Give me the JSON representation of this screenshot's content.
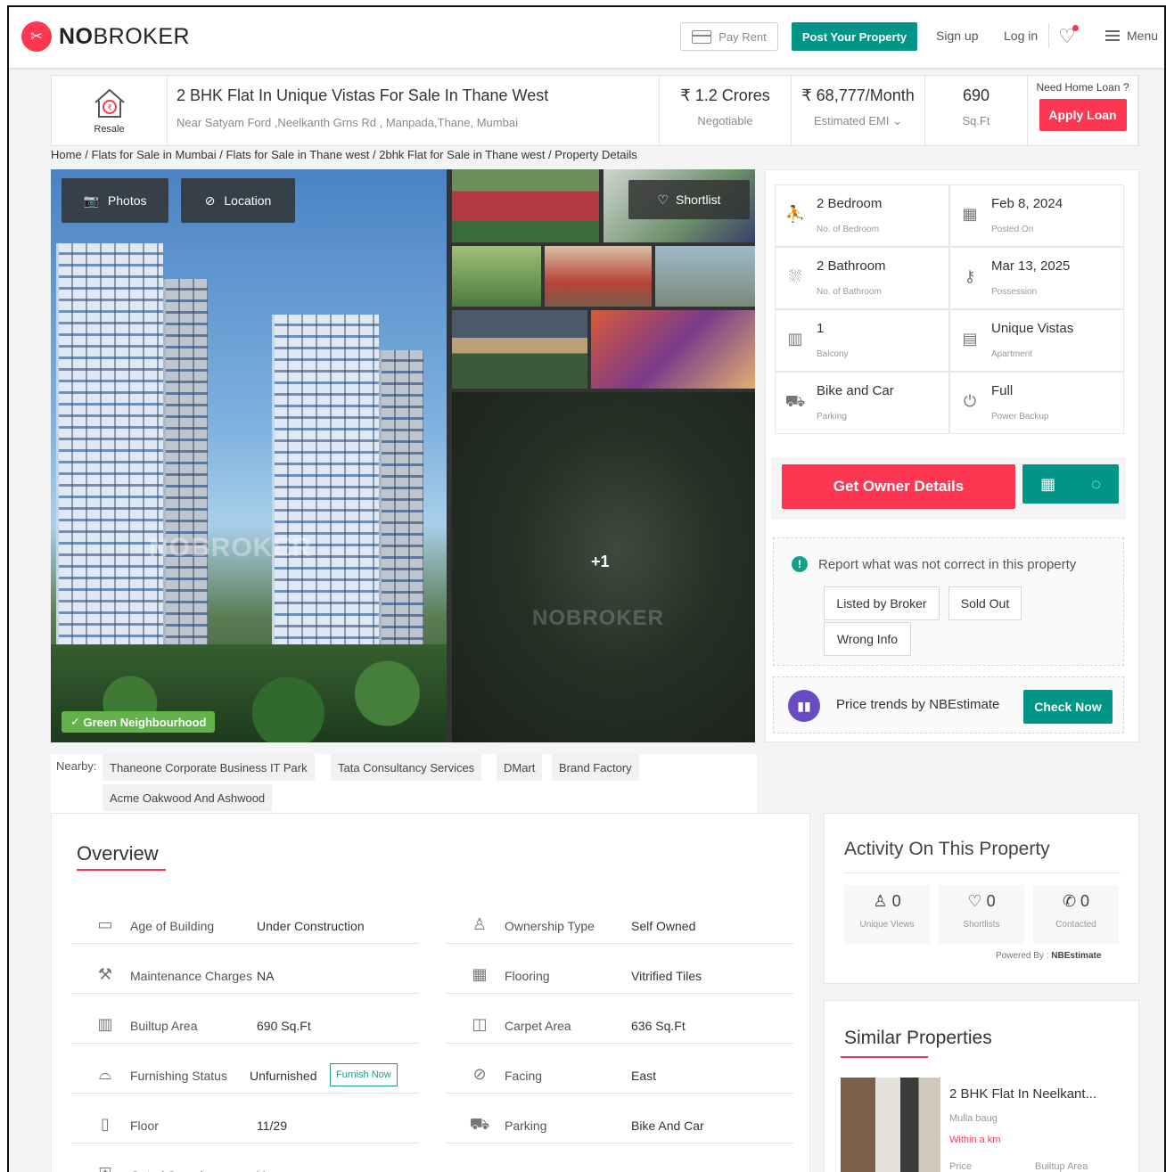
{
  "header": {
    "brand_bold": "NO",
    "brand_rest": "BROKER",
    "pay_rent": "Pay Rent",
    "post_property": "Post Your Property",
    "sign_up": "Sign up",
    "log_in": "Log in",
    "menu": "Menu"
  },
  "property": {
    "resale_label": "Resale",
    "title": "2 BHK Flat In Unique Vistas For Sale In Thane West",
    "address": "Near Satyam Ford ,Neelkanth Grns Rd , Manpada,Thane, Mumbai",
    "price": "₹ 1.2 Crores",
    "price_sub": "Negotiable",
    "emi": "₹ 68,777/Month",
    "emi_sub": "Estimated EMI",
    "area": "690",
    "area_sub": "Sq.Ft",
    "loan_q": "Need Home Loan ?",
    "apply_loan": "Apply Loan"
  },
  "breadcrumb": "Home / Flats for Sale in Mumbai / Flats for Sale in Thane west / 2bhk Flat for Sale in Thane west / Property Details",
  "gallery": {
    "photos": "Photos",
    "location": "Location",
    "shortlist": "Shortlist",
    "badge": "Green Neighbourhood",
    "more": "+1",
    "watermark": "NOBROKER"
  },
  "specs": [
    {
      "value": "2 Bedroom",
      "label": "No. of Bedroom"
    },
    {
      "value": "Feb 8, 2024",
      "label": "Posted On"
    },
    {
      "value": "2 Bathroom",
      "label": "No. of Bathroom"
    },
    {
      "value": "Mar 13, 2025",
      "label": "Possession"
    },
    {
      "value": "1",
      "label": "Balcony"
    },
    {
      "value": "Unique Vistas",
      "label": "Apartment"
    },
    {
      "value": "Bike and Car",
      "label": "Parking"
    },
    {
      "value": "Full",
      "label": "Power Backup"
    }
  ],
  "owner": {
    "button": "Get Owner Details"
  },
  "report": {
    "title": "Report what was not correct in this property",
    "options": [
      "Listed by Broker",
      "Sold Out",
      "Wrong Info"
    ]
  },
  "trend": {
    "text": "Price trends by NBEstimate",
    "button": "Check Now"
  },
  "nearby": {
    "label": "Nearby:",
    "items": [
      "Thaneone Corporate Business IT Park",
      "Tata Consultancy Services",
      "DMart",
      "Brand Factory",
      "Acme Oakwood And Ashwood"
    ]
  },
  "overview": {
    "title": "Overview",
    "furnish_now": "Furnish Now",
    "left": [
      {
        "k": "Age of Building",
        "v": "Under Construction"
      },
      {
        "k": "Maintenance Charges",
        "v": "NA"
      },
      {
        "k": "Builtup Area",
        "v": "690 Sq.Ft"
      },
      {
        "k": "Furnishing Status",
        "v": "Unfurnished"
      },
      {
        "k": "Floor",
        "v": "11/29"
      },
      {
        "k": "Gated Security",
        "v": "Yes"
      }
    ],
    "right": [
      {
        "k": "Ownership Type",
        "v": "Self Owned"
      },
      {
        "k": "Flooring",
        "v": "Vitrified Tiles"
      },
      {
        "k": "Carpet Area",
        "v": "636 Sq.Ft"
      },
      {
        "k": "Facing",
        "v": "East"
      },
      {
        "k": "Parking",
        "v": "Bike And Car"
      }
    ]
  },
  "activity": {
    "title": "Activity On This Property",
    "stats": [
      {
        "n": "0",
        "l": "Unique Views"
      },
      {
        "n": "0",
        "l": "Shortlists"
      },
      {
        "n": "0",
        "l": "Contacted"
      }
    ],
    "powered_label": "Powered By :",
    "powered_by": "NBEstimate"
  },
  "similar": {
    "title": "Similar Properties",
    "item_title": "2 BHK Flat In Neelkant...",
    "item_sub": "Mulla baug",
    "item_dist": "Within a km",
    "price_label": "Price",
    "area_label": "Builtup Area"
  },
  "colors": {
    "brand": "#fd3752",
    "accent": "#009587"
  }
}
